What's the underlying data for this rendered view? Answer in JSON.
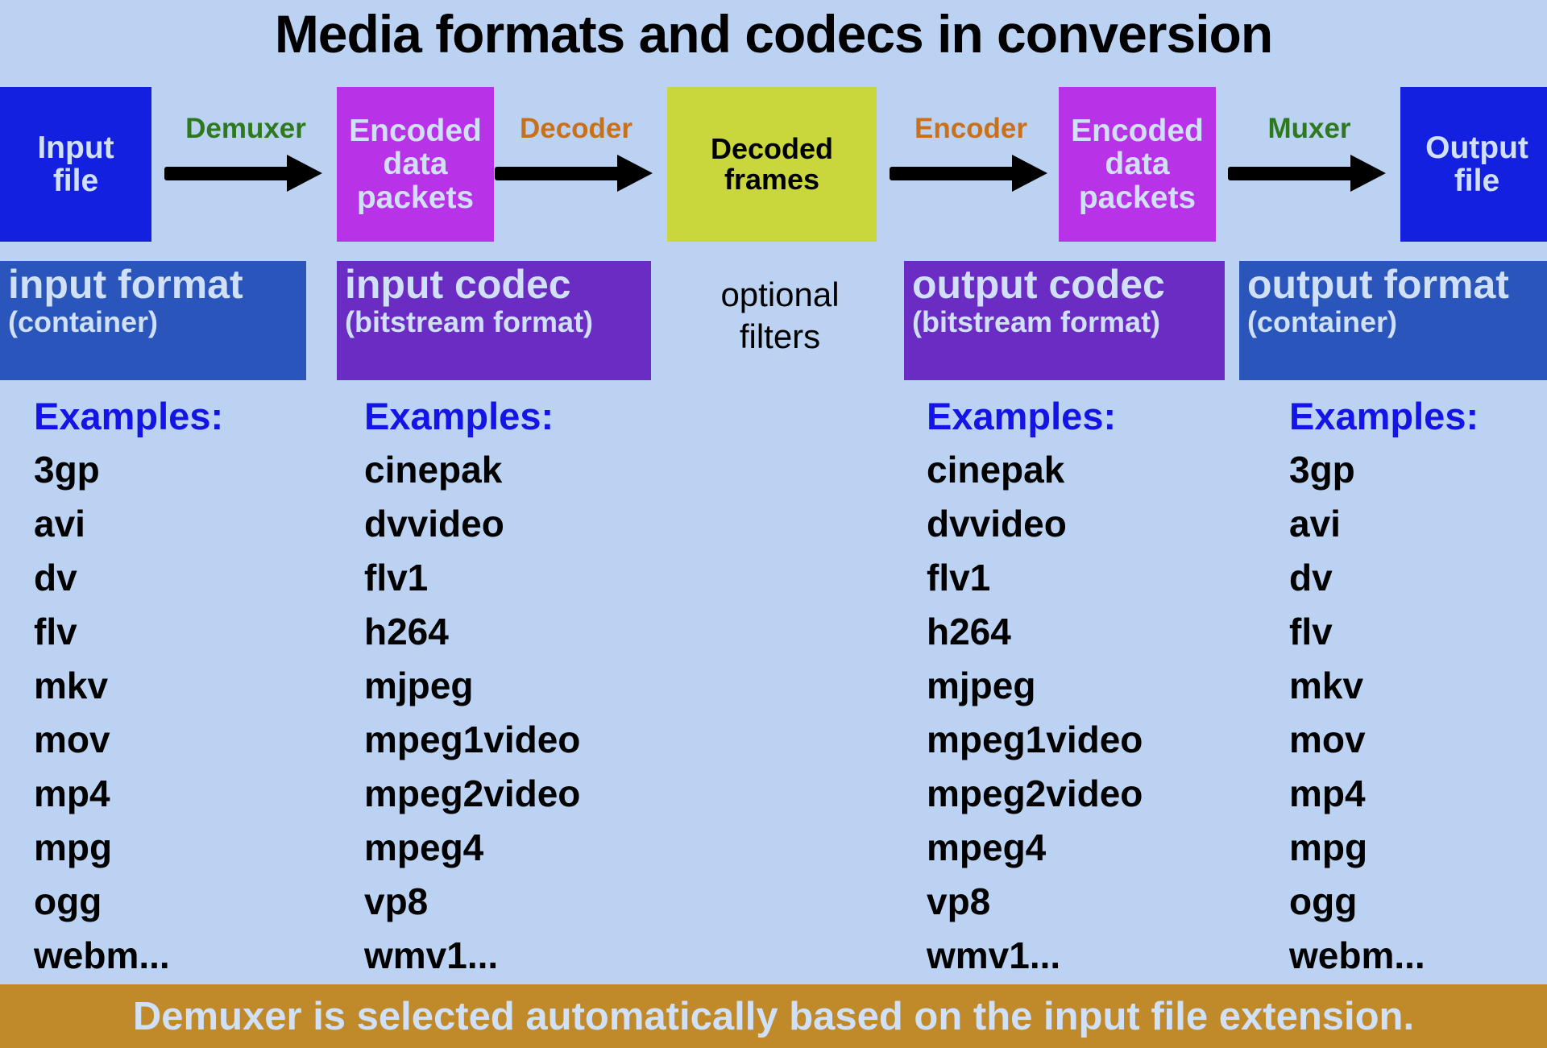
{
  "title": "Media formats and codecs in conversion",
  "colors": {
    "background": "#bcd2f2",
    "file_box": "#1420e0",
    "packets_box": "#b832e8",
    "frames_box": "#c9d63c",
    "banner_format": "#2a55bb",
    "banner_codec": "#6a2cc2",
    "process_muxing": "#2d7a1e",
    "process_coding": "#c8701a",
    "examples_heading": "#1414e6",
    "footer_background": "#c0892a",
    "light_text": "#cfe0f7"
  },
  "pipeline": {
    "boxes": [
      {
        "id": "input-file",
        "label": "Input\nfile"
      },
      {
        "id": "encoded-packets-in",
        "label": "Encoded\ndata\npackets"
      },
      {
        "id": "decoded-frames",
        "label": "Decoded\nframes"
      },
      {
        "id": "encoded-packets-out",
        "label": "Encoded\ndata\npackets"
      },
      {
        "id": "output-file",
        "label": "Output\nfile"
      }
    ],
    "processes": [
      {
        "id": "demuxer",
        "label": "Demuxer",
        "icon": "arrow-right-icon"
      },
      {
        "id": "decoder",
        "label": "Decoder",
        "icon": "arrow-right-icon"
      },
      {
        "id": "encoder",
        "label": "Encoder",
        "icon": "arrow-right-icon"
      },
      {
        "id": "muxer",
        "label": "Muxer",
        "icon": "arrow-right-icon"
      }
    ]
  },
  "categories": {
    "input_format": {
      "main": "input format",
      "sub": "(container)"
    },
    "input_codec": {
      "main": "input codec",
      "sub": "(bitstream format)"
    },
    "optional": {
      "label": "optional\nfilters"
    },
    "output_codec": {
      "main": "output codec",
      "sub": "(bitstream format)"
    },
    "output_format": {
      "main": "output format",
      "sub": "(container)"
    }
  },
  "examples": {
    "heading": "Examples:",
    "input_format": [
      "3gp",
      "avi",
      "dv",
      "flv",
      "mkv",
      "mov",
      "mp4",
      "mpg",
      "ogg",
      "webm..."
    ],
    "input_codec": [
      "cinepak",
      "dvvideo",
      "flv1",
      "h264",
      "mjpeg",
      "mpeg1video",
      "mpeg2video",
      "mpeg4",
      "vp8",
      "wmv1..."
    ],
    "output_codec": [
      "cinepak",
      "dvvideo",
      "flv1",
      "h264",
      "mjpeg",
      "mpeg1video",
      "mpeg2video",
      "mpeg4",
      "vp8",
      "wmv1..."
    ],
    "output_format": [
      "3gp",
      "avi",
      "dv",
      "flv",
      "mkv",
      "mov",
      "mp4",
      "mpg",
      "ogg",
      "webm..."
    ]
  },
  "footer": {
    "note": "Demuxer is selected automatically based on the input file extension."
  }
}
